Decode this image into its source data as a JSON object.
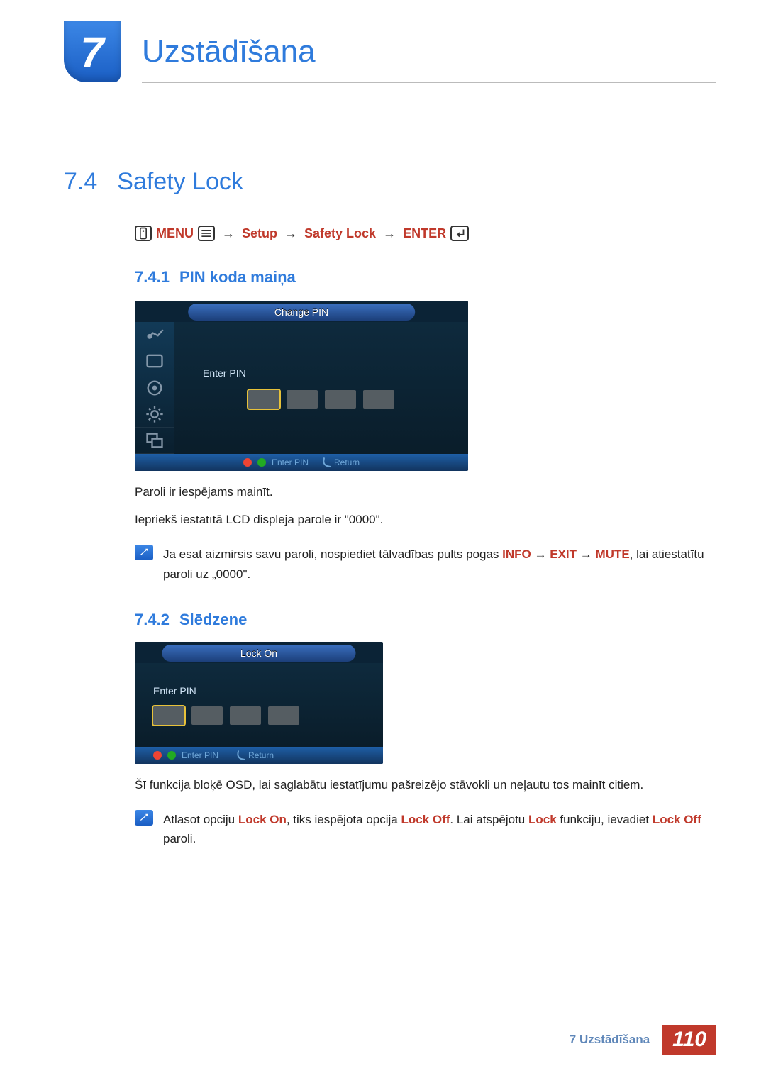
{
  "chapter": {
    "number": "7",
    "title": "Uzstādīšana"
  },
  "section": {
    "number": "7.4",
    "title": "Safety Lock"
  },
  "breadcrumb": {
    "menu": "MENU",
    "setup": "Setup",
    "safety_lock": "Safety Lock",
    "enter": "ENTER",
    "arrow": "→"
  },
  "sub1": {
    "number": "7.4.1",
    "title": "PIN koda maiņa"
  },
  "osd1": {
    "title": "Change PIN",
    "label": "Enter PIN",
    "footer_enter": "Enter PIN",
    "footer_return": "Return"
  },
  "body1a": "Paroli ir iespējams mainīt.",
  "body1b": "Iepriekš iestatītā LCD displeja parole ir \"0000\".",
  "note1": {
    "pre": "Ja esat aizmirsis savu paroli, nospiediet tālvadības pults pogas ",
    "info": "INFO",
    "exit": "EXIT",
    "mute": "MUTE",
    "post": ", lai atiestatītu paroli uz „0000\".",
    "arrow": "→"
  },
  "sub2": {
    "number": "7.4.2",
    "title": "Slēdzene"
  },
  "osd2": {
    "title": "Lock On",
    "label": "Enter PIN",
    "footer_enter": "Enter PIN",
    "footer_return": "Return"
  },
  "body2": "Šī funkcija bloķē OSD, lai saglabātu iestatījumu pašreizējo stāvokli un neļautu tos mainīt citiem.",
  "note2": {
    "pre": "Atlasot opciju ",
    "lock_on": "Lock On",
    "mid1": ", tiks iespējota opcija ",
    "lock_off1": "Lock Off",
    "mid2": ". Lai atspējotu ",
    "lock": "Lock",
    "mid3": " funkciju, ievadiet ",
    "lock_off2": "Lock Off",
    "post": " paroli."
  },
  "footer": {
    "label": "7 Uzstādīšana",
    "page": "110"
  }
}
